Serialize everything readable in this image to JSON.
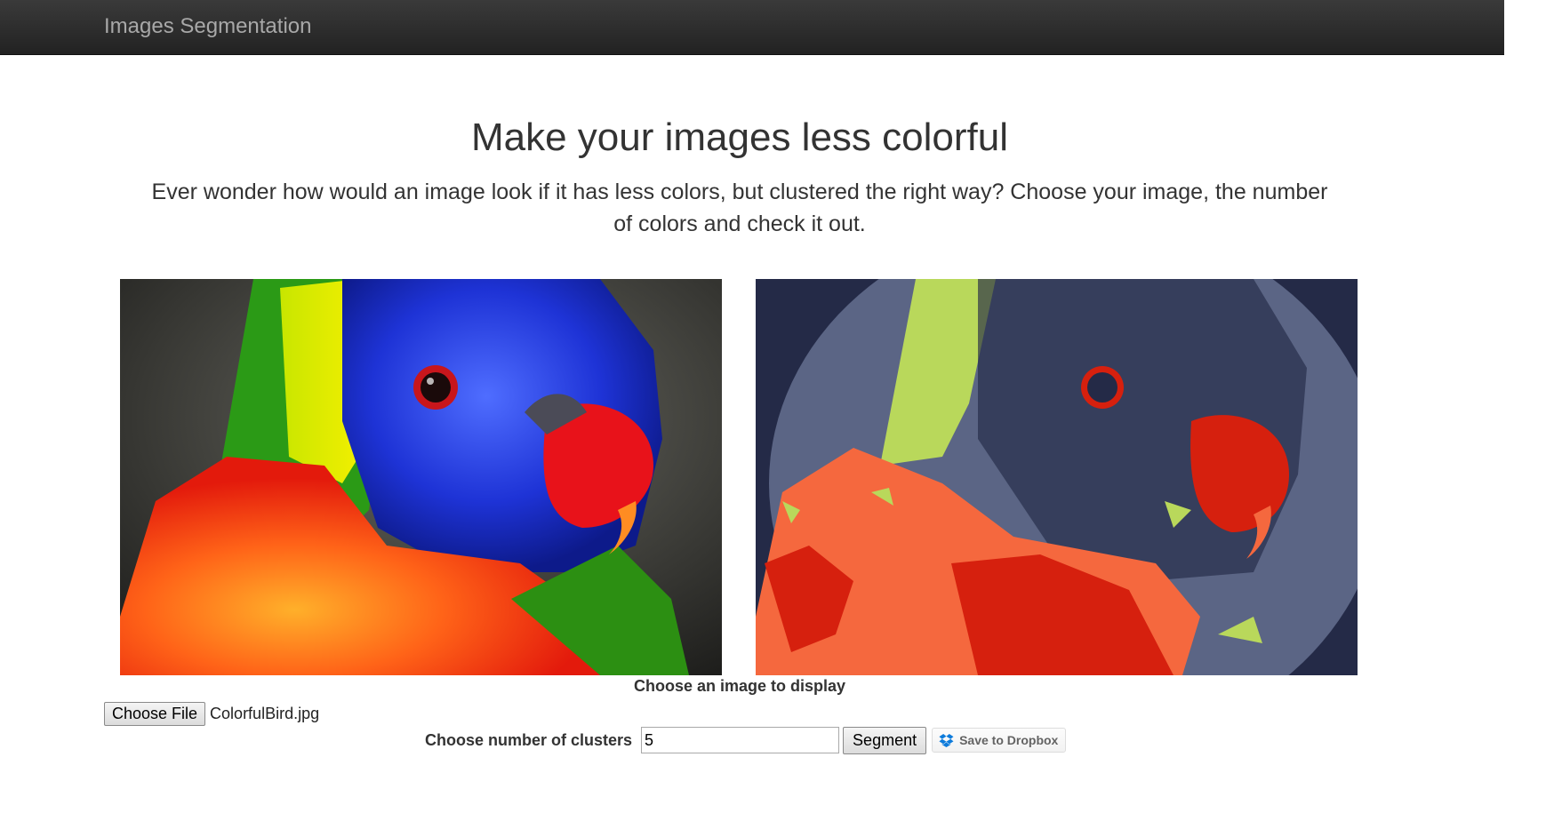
{
  "navbar": {
    "brand": "Images Segmentation"
  },
  "hero": {
    "title": "Make your images less colorful",
    "subtitle": "Ever wonder how would an image look if it has less colors, but clustered the right way? Choose your image, the number of colors and check it out."
  },
  "images": {
    "original_subject": "rainbow lorikeet photo",
    "segmented_subject": "rainbow lorikeet segmented into 5 color clusters",
    "segmented_palette": [
      "#242a47",
      "#5b6585",
      "#b9d85b",
      "#f5683e",
      "#d6200e"
    ]
  },
  "form": {
    "display_label": "Choose an image to display",
    "file_button_label": "Choose File",
    "file_name": "ColorfulBird.jpg",
    "clusters_label": "Choose number of clusters",
    "clusters_value": "5",
    "segment_button_label": "Segment",
    "dropbox_button_label": "Save to Dropbox",
    "dropbox_icon": "dropbox-icon"
  },
  "colors": {
    "navbar_bg": "#2b2b2b",
    "brand_text": "#a8a8a8",
    "dropbox_blue": "#0d7bdb"
  }
}
